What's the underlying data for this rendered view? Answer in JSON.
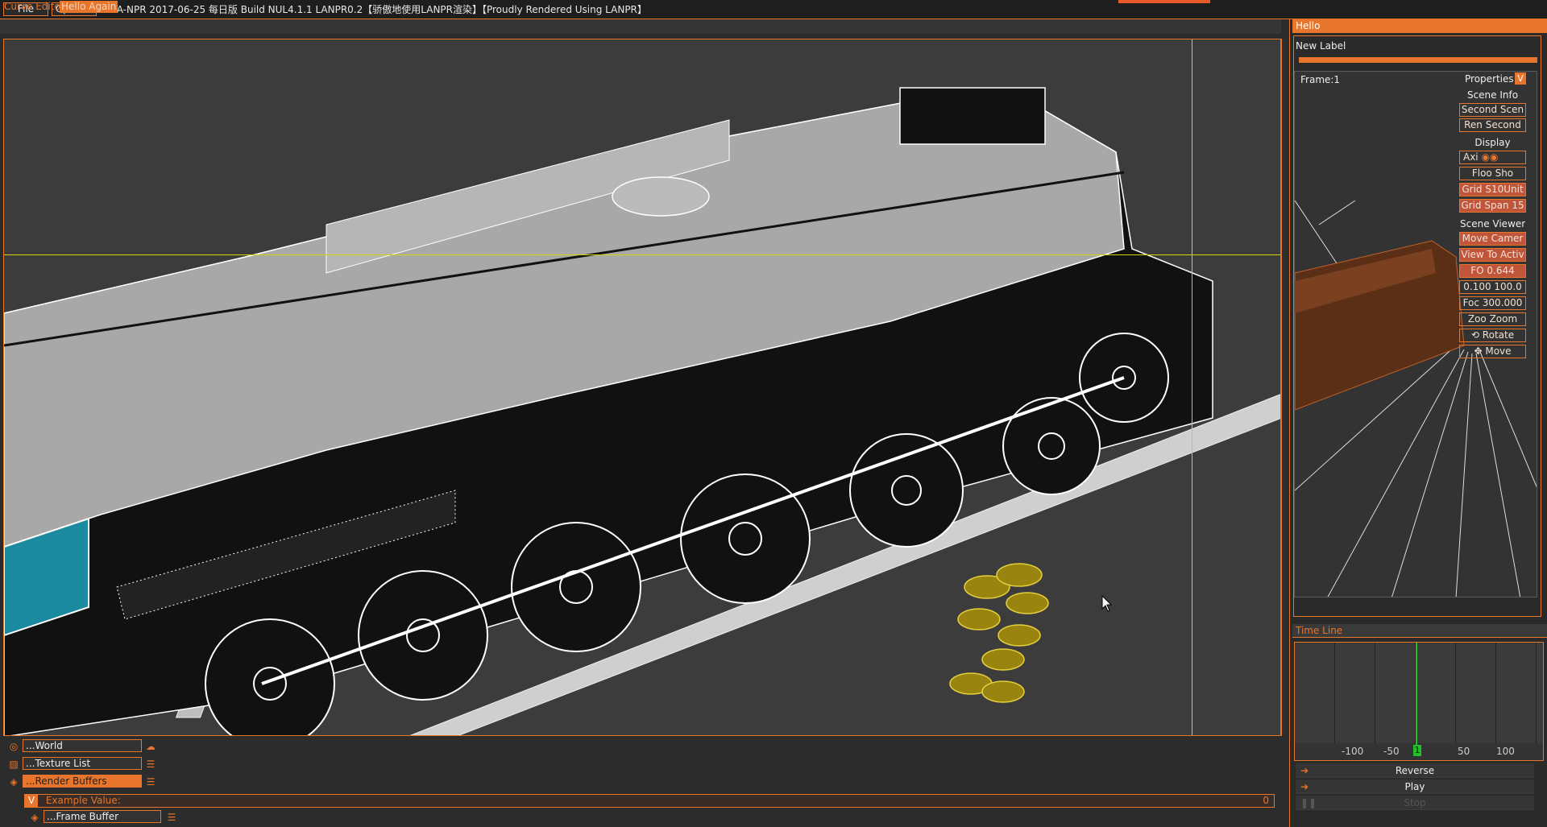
{
  "menu": {
    "file": "File",
    "options": "Options"
  },
  "window_title": "LA-NPR 2017-06-25 每日版 Build NUL4.1.1 LANPR0.2【骄傲地使用LANPR渲染】【Proudly Rendered Using LANPR】",
  "tabs": [
    {
      "label": "Curve Editor"
    },
    {
      "label": "Hello Again"
    }
  ],
  "bottom_panel": {
    "world": "...World",
    "texture_list": "...Texture List",
    "render_buffers": "...Render Buffers",
    "example_label": "Example Value:",
    "example_toggle": "V",
    "example_value": "0",
    "frame_buffer": "...Frame Buffer"
  },
  "right_panel": {
    "title": "Hello",
    "new_label": "New Label",
    "frame": "Frame:1",
    "properties": "Properties",
    "properties_toggle": "V",
    "items": [
      {
        "text": "Scene Info",
        "style": "label"
      },
      {
        "text": "Second Scen",
        "style": "outline"
      },
      {
        "text": "Ren  Second",
        "style": "outline"
      },
      {
        "text": "Display",
        "style": "label"
      },
      {
        "text": "Axi",
        "style": "outline"
      },
      {
        "text": "Floo  Sho",
        "style": "outline"
      },
      {
        "text": "Grid S10Unit",
        "style": "fill"
      },
      {
        "text": "Grid Span 15",
        "style": "fill"
      },
      {
        "text": "Scene Viewer",
        "style": "label"
      },
      {
        "text": "Move Camer",
        "style": "fill"
      },
      {
        "text": "View To Activ",
        "style": "fill"
      },
      {
        "text": "FO 0.644",
        "style": "fill"
      },
      {
        "text": "0.100 100.0",
        "style": "outline"
      },
      {
        "text": "Foc  300.000",
        "style": "outline"
      },
      {
        "text": "Zoo  Zoom",
        "style": "outline"
      },
      {
        "text": "Rotate",
        "style": "outline"
      },
      {
        "text": "Move",
        "style": "outline"
      }
    ]
  },
  "timeline": {
    "title": "Time Line",
    "ticks": [
      "-100",
      "-50",
      "1",
      "50",
      "100"
    ],
    "reverse": "Reverse",
    "play": "Play",
    "stop": "Stop"
  },
  "colors": {
    "accent": "#e7752b",
    "background": "#2b2b2b",
    "guide": "#d8d000",
    "selection": "#9a8410"
  }
}
